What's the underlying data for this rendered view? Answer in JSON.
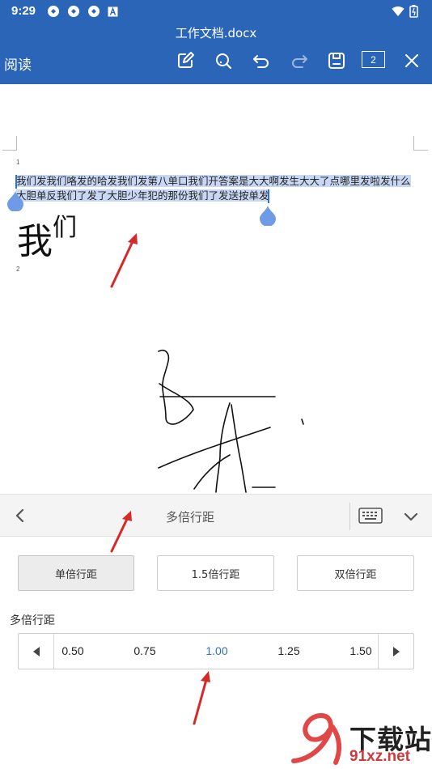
{
  "status_bar": {
    "time": "9:29"
  },
  "header": {
    "doc_title": "工作文档.docx",
    "read_label": "阅读",
    "page_count": "2"
  },
  "document": {
    "line_number_1": "1",
    "line_number_2": "2",
    "paragraph_line1": "我们发我们咯发的哈发我们发第八单口我们开答案是大大啊发生大大了点哪里发啦发什么",
    "paragraph_line2": "大胆单反我们了发了大胆少年犯的那份我们了发送按单发",
    "big_text_main": "我",
    "big_text_small": "们"
  },
  "panel": {
    "title": "多倍行距",
    "buttons": {
      "single": "单倍行距",
      "one_half": "1.5倍行距",
      "double": "双倍行距"
    },
    "multi_label": "多倍行距",
    "values": [
      "0.50",
      "0.75",
      "1.00",
      "1.25",
      "1.50"
    ],
    "selected_value": "1.00"
  },
  "watermark": {
    "brand": "下载站",
    "site": "91xz.net"
  },
  "colors": {
    "header_bg": "#2b65b8",
    "selection": "#c8d8f4",
    "accent": "#2f6fc6",
    "arrow": "#d42a2a"
  }
}
